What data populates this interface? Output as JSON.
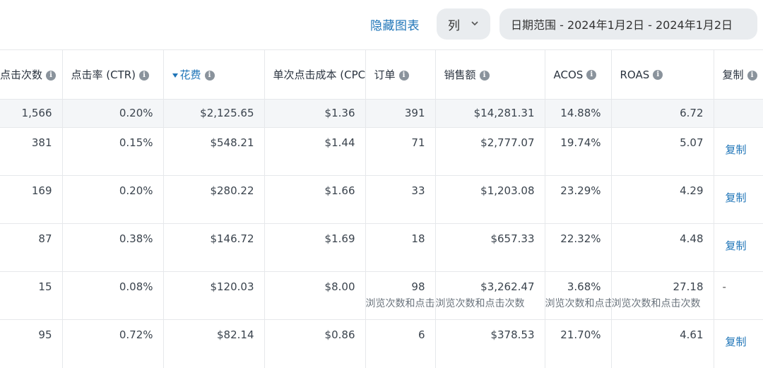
{
  "toolbar": {
    "hide_chart": "隐藏图表",
    "columns": "列",
    "date_range": "日期范围 - 2024年1月2日 - 2024年1月2日"
  },
  "headers": [
    "点击次数",
    "点击率 (CTR)",
    "花费",
    "单次点击成本 (CPC)",
    "订单",
    "销售额",
    "ACOS",
    "ROAS",
    "复制"
  ],
  "totals": {
    "clicks": "1,566",
    "ctr": "0.20%",
    "spend": "$2,125.65",
    "cpc": "$1.36",
    "orders": "391",
    "sales": "$14,281.31",
    "acos": "14.88%",
    "roas": "6.72"
  },
  "rows": [
    {
      "clicks": "381",
      "ctr": "0.15%",
      "spend": "$548.21",
      "cpc": "$1.44",
      "orders": "71",
      "sales": "$2,777.07",
      "acos": "19.74%",
      "roas": "5.07",
      "copy": "复制"
    },
    {
      "clicks": "169",
      "ctr": "0.20%",
      "spend": "$280.22",
      "cpc": "$1.66",
      "orders": "33",
      "sales": "$1,203.08",
      "acos": "23.29%",
      "roas": "4.29",
      "copy": "复制"
    },
    {
      "clicks": "87",
      "ctr": "0.38%",
      "spend": "$146.72",
      "cpc": "$1.69",
      "orders": "18",
      "sales": "$657.33",
      "acos": "22.32%",
      "roas": "4.48",
      "copy": "复制"
    },
    {
      "clicks": "15",
      "ctr": "0.08%",
      "spend": "$120.03",
      "cpc": "$8.00",
      "orders": "98",
      "sales": "$3,262.47",
      "acos": "3.68%",
      "roas": "27.18",
      "copy": "-",
      "note": "浏览次数和点击次数"
    },
    {
      "clicks": "95",
      "ctr": "0.72%",
      "spend": "$82.14",
      "cpc": "$0.86",
      "orders": "6",
      "sales": "$378.53",
      "acos": "21.70%",
      "roas": "4.61",
      "copy": "复制"
    }
  ]
}
